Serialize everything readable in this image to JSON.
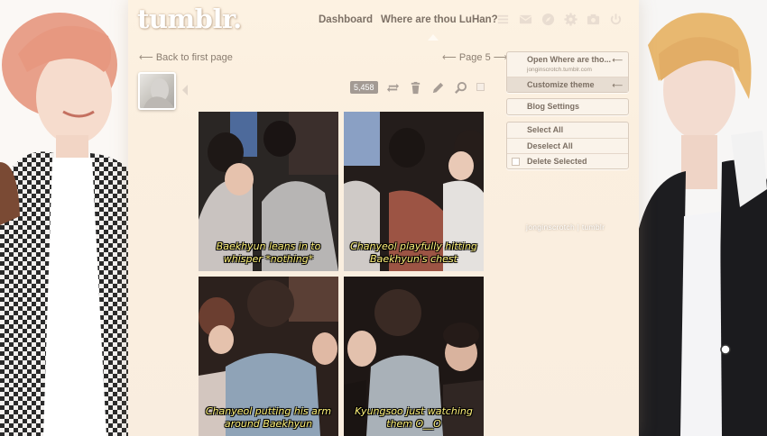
{
  "header": {
    "logo": "tumblr.",
    "nav": {
      "dashboard": "Dashboard",
      "blog_link": "Where are thou LuHan?"
    },
    "icons": [
      "list-icon",
      "mail-icon",
      "compass-icon",
      "gear-icon",
      "camera-icon",
      "power-icon"
    ]
  },
  "pager": {
    "back_label": "Back to first page",
    "page_label": "Page 5"
  },
  "post": {
    "notes_count": "5,458",
    "gifs": [
      {
        "caption_line1": "Baekhyun leans in to",
        "caption_line2": "whisper *nothing*"
      },
      {
        "caption_line1": "Chanyeol playfully hitting",
        "caption_line2": "Baekhyun's chest"
      },
      {
        "caption_line1": "Chanyeol putting his arm",
        "caption_line2": "around Baekhyun"
      },
      {
        "caption_line1": "Kyungsoo just watching",
        "caption_line2": "them O__O"
      }
    ]
  },
  "sidebar": {
    "open_blog": "Open Where are tho...",
    "open_blog_url": "jonginscrotch.tumblr.com",
    "customize_theme": "Customize theme",
    "blog_settings": "Blog Settings",
    "select_all": "Select All",
    "deselect_all": "Deselect All",
    "delete_selected": "Delete Selected",
    "watermark": "jonginscrotch | tumblr"
  },
  "colors": {
    "caption_yellow": "#fff27a",
    "page_background": "#fbefdf",
    "notes_badge": "#a39a93"
  }
}
